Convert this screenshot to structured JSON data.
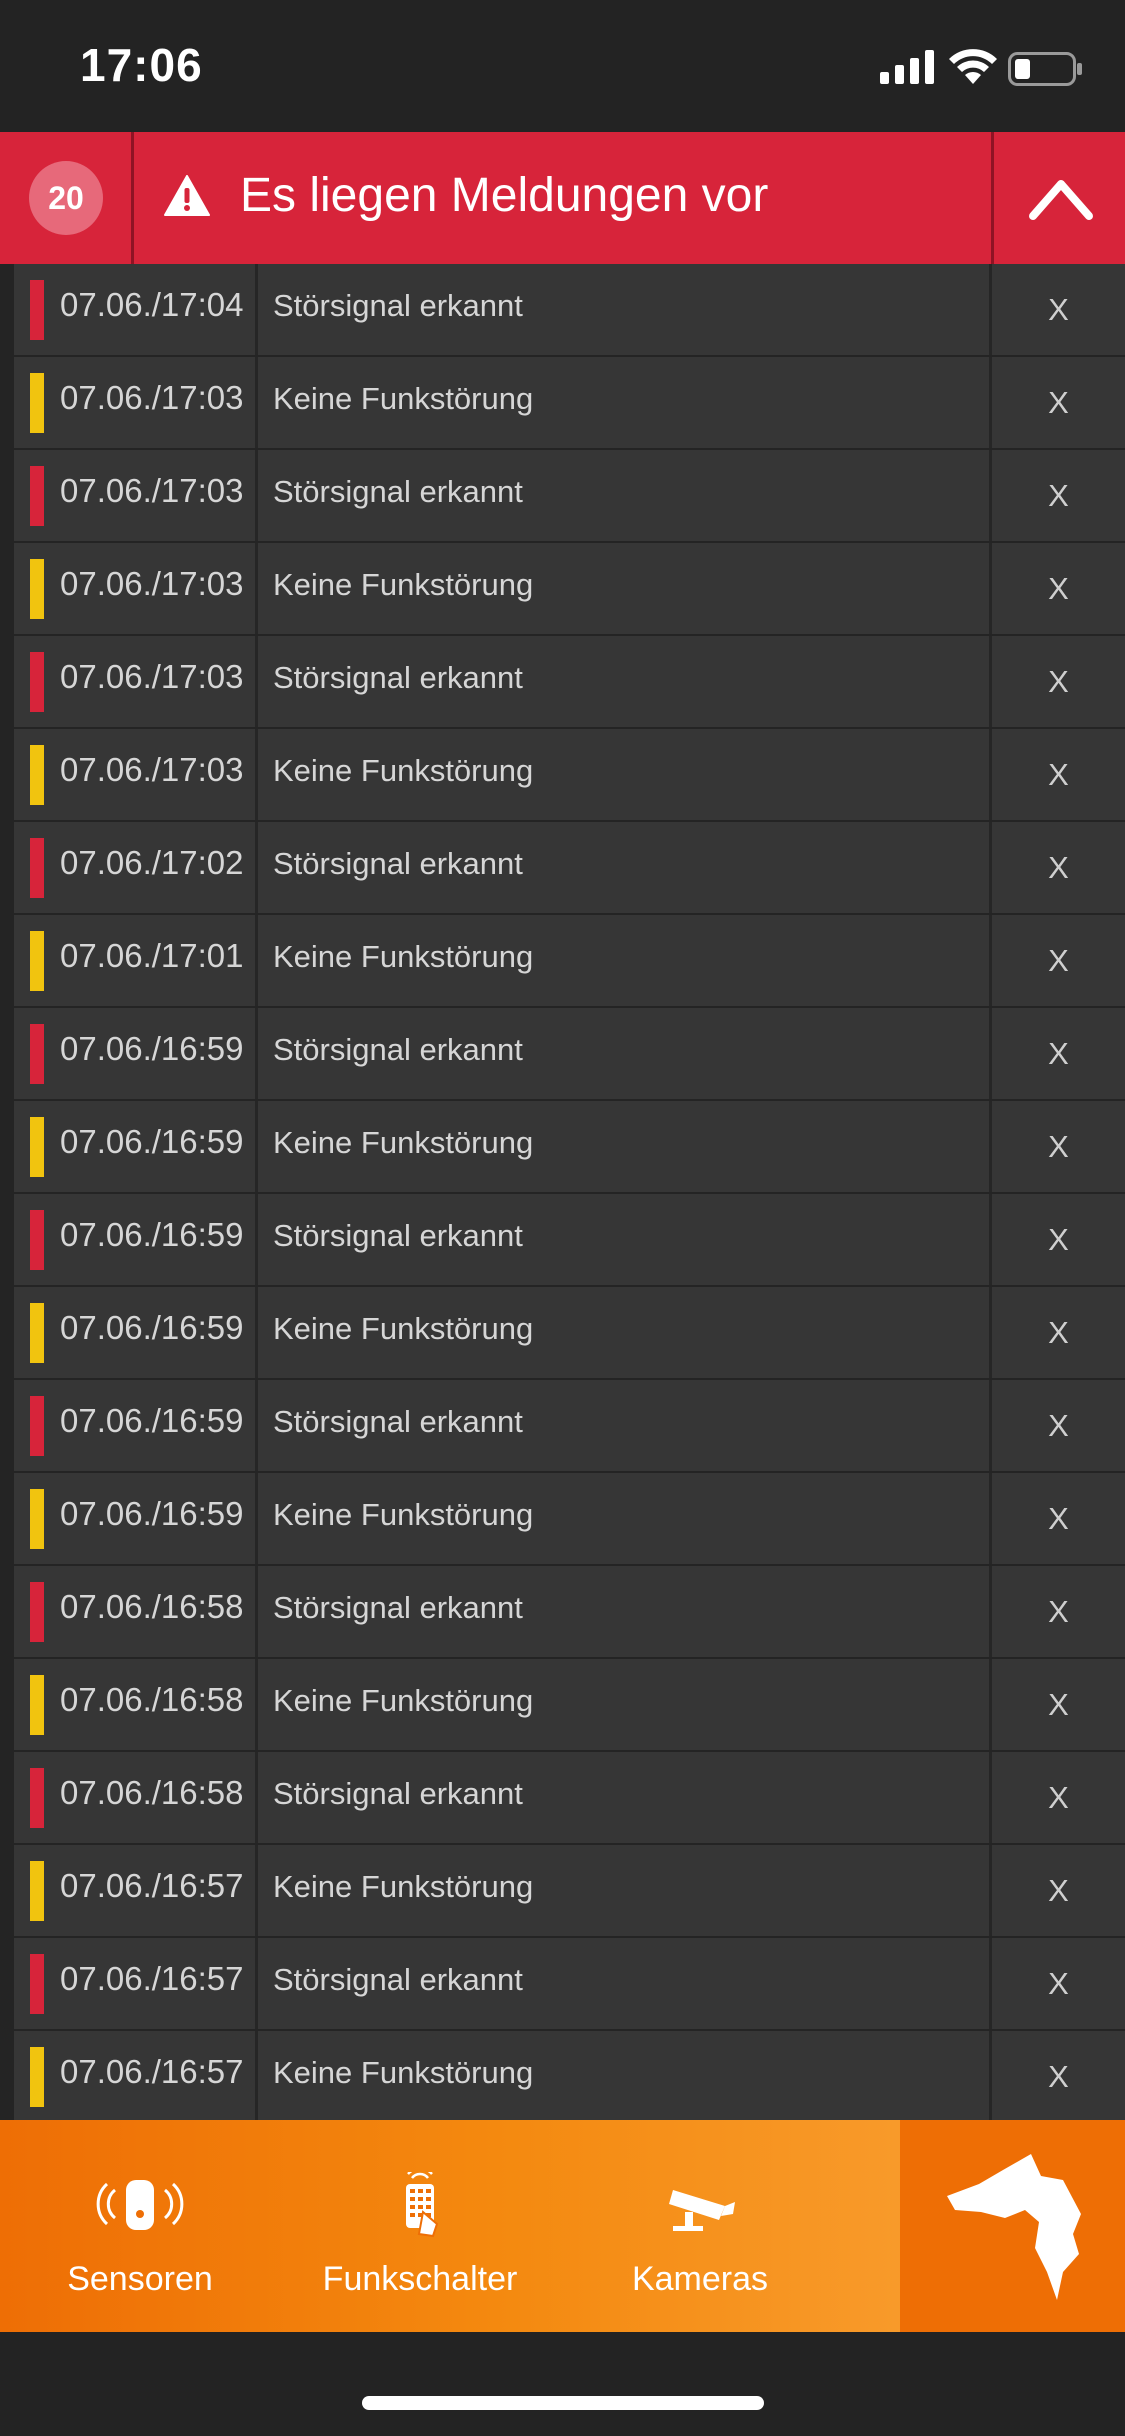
{
  "status_bar": {
    "time": "17:06",
    "icons": [
      "cellular-signal-icon",
      "wifi-icon",
      "battery-icon"
    ],
    "battery_level": 0.25
  },
  "alert": {
    "count": "20",
    "icon": "warning-triangle-icon",
    "title": "Es liegen Meldungen vor",
    "toggle_icon": "chevron-up-icon",
    "background": "#d7243a"
  },
  "colors": {
    "red_marker": "#d7243a",
    "yellow_marker": "#f1c40f",
    "row_background": "#363636",
    "tabbar_orange": "#ee6e05"
  },
  "messages": [
    {
      "time": "07.06./17:04",
      "text": "Störsignal erkannt",
      "level": "red",
      "close": "X"
    },
    {
      "time": "07.06./17:03",
      "text": "Keine Funkstörung",
      "level": "yellow",
      "close": "X"
    },
    {
      "time": "07.06./17:03",
      "text": "Störsignal erkannt",
      "level": "red",
      "close": "X"
    },
    {
      "time": "07.06./17:03",
      "text": "Keine Funkstörung",
      "level": "yellow",
      "close": "X"
    },
    {
      "time": "07.06./17:03",
      "text": "Störsignal erkannt",
      "level": "red",
      "close": "X"
    },
    {
      "time": "07.06./17:03",
      "text": "Keine Funkstörung",
      "level": "yellow",
      "close": "X"
    },
    {
      "time": "07.06./17:02",
      "text": "Störsignal erkannt",
      "level": "red",
      "close": "X"
    },
    {
      "time": "07.06./17:01",
      "text": "Keine Funkstörung",
      "level": "yellow",
      "close": "X"
    },
    {
      "time": "07.06./16:59",
      "text": "Störsignal erkannt",
      "level": "red",
      "close": "X"
    },
    {
      "time": "07.06./16:59",
      "text": "Keine Funkstörung",
      "level": "yellow",
      "close": "X"
    },
    {
      "time": "07.06./16:59",
      "text": "Störsignal erkannt",
      "level": "red",
      "close": "X"
    },
    {
      "time": "07.06./16:59",
      "text": "Keine Funkstörung",
      "level": "yellow",
      "close": "X"
    },
    {
      "time": "07.06./16:59",
      "text": "Störsignal erkannt",
      "level": "red",
      "close": "X"
    },
    {
      "time": "07.06./16:59",
      "text": "Keine Funkstörung",
      "level": "yellow",
      "close": "X"
    },
    {
      "time": "07.06./16:58",
      "text": "Störsignal erkannt",
      "level": "red",
      "close": "X"
    },
    {
      "time": "07.06./16:58",
      "text": "Keine Funkstörung",
      "level": "yellow",
      "close": "X"
    },
    {
      "time": "07.06./16:58",
      "text": "Störsignal erkannt",
      "level": "red",
      "close": "X"
    },
    {
      "time": "07.06./16:57",
      "text": "Keine Funkstörung",
      "level": "yellow",
      "close": "X"
    },
    {
      "time": "07.06./16:57",
      "text": "Störsignal erkannt",
      "level": "red",
      "close": "X"
    },
    {
      "time": "07.06./16:57",
      "text": "Keine Funkstörung",
      "level": "yellow",
      "close": "X"
    }
  ],
  "tabbar": {
    "tabs": [
      {
        "label": "Sensoren",
        "icon": "sensor-icon"
      },
      {
        "label": "Funkschalter",
        "icon": "remote-switch-icon"
      },
      {
        "label": "Kameras",
        "icon": "camera-icon"
      }
    ],
    "brand_icon": "wolf-logo-icon"
  }
}
